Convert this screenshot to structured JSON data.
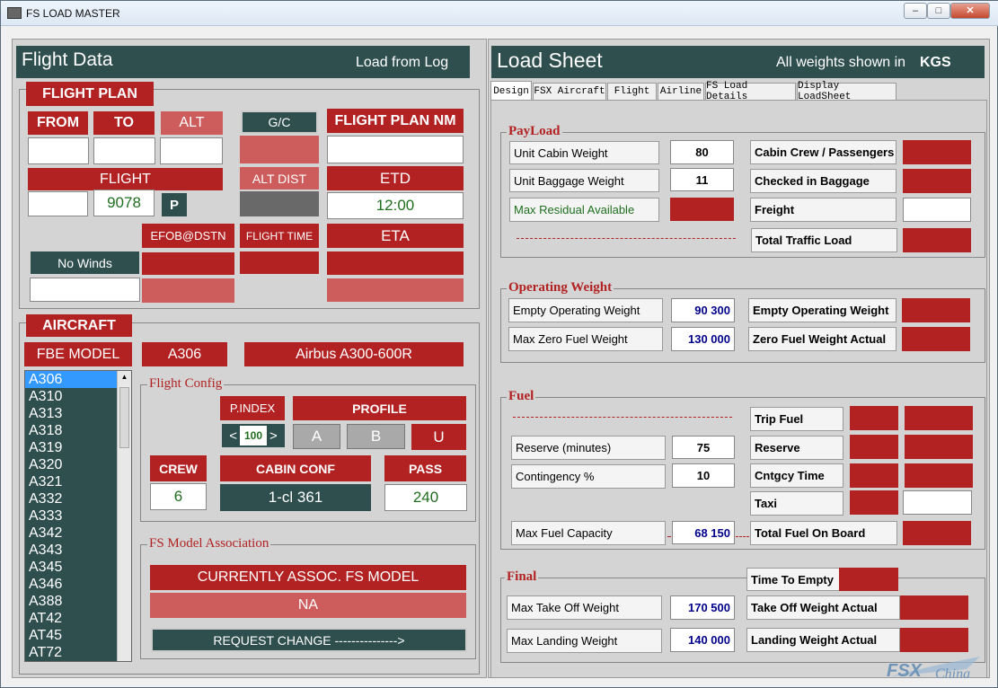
{
  "window": {
    "title": "FS LOAD MASTER"
  },
  "left": {
    "title": "Flight Data",
    "load_log": "Load from Log",
    "flight_plan": {
      "header": "FLIGHT PLAN",
      "from": "FROM",
      "to": "TO",
      "alt": "ALT",
      "gc": "G/C",
      "fp_nm": "FLIGHT PLAN NM",
      "flight": "FLIGHT",
      "flight_no": "9078",
      "p": "P",
      "alt_dist": "ALT DIST",
      "etd": "ETD",
      "etd_value": "12:00",
      "efob": "EFOB@DSTN",
      "flight_time": "FLIGHT TIME",
      "eta": "ETA",
      "no_winds": "No Winds"
    },
    "aircraft": {
      "header": "AIRCRAFT",
      "fbe_model": "FBE MODEL",
      "model": "A306",
      "model_name": "Airbus A300-600R",
      "list": [
        "A306",
        "A310",
        "A313",
        "A318",
        "A319",
        "A320",
        "A321",
        "A332",
        "A333",
        "A342",
        "A343",
        "A345",
        "A346",
        "A388",
        "AT42",
        "AT45",
        "AT72"
      ],
      "flight_config": "Flight Config",
      "pindex": "P.INDEX",
      "pindex_value": "100",
      "profile": "PROFILE",
      "a": "A",
      "b": "B",
      "u": "U",
      "crew": "CREW",
      "crew_value": "6",
      "cabin_conf": "CABIN CONF",
      "cabin_conf_value": "1-cl  361",
      "pass": "PASS",
      "pass_value": "240",
      "fs_assoc": "FS Model Association",
      "curr_assoc": "CURRENTLY ASSOC.  FS MODEL",
      "assoc_value": "NA",
      "request_change": "REQUEST CHANGE --------------->"
    }
  },
  "right": {
    "title": "Load Sheet",
    "weights_note": "All weights shown in",
    "unit": "KGS",
    "tabs": [
      "Design",
      "FSX Aircraft",
      "Flight",
      "Airline",
      "FS Load Details",
      "Display LoadSheet"
    ],
    "payload": {
      "legend": "PayLoad",
      "unit_cabin": "Unit Cabin Weight",
      "unit_cabin_value": "80",
      "unit_bag": "Unit Baggage Weight",
      "unit_bag_value": "11",
      "max_resid": "Max Residual Available",
      "crew_pax": "Cabin Crew / Passengers",
      "checked_bag": "Checked in Baggage",
      "freight": "Freight",
      "total_traffic": "Total Traffic Load"
    },
    "operating": {
      "legend": "Operating Weight",
      "empty_op": "Empty Operating Weight",
      "empty_op_value": "90 300",
      "max_zf": "Max Zero Fuel Weight",
      "max_zf_value": "130 000",
      "empty_op_r": "Empty Operating Weight",
      "zfw_actual": "Zero Fuel Weight Actual"
    },
    "fuel": {
      "legend": "Fuel",
      "trip": "Trip Fuel",
      "reserve_min": "Reserve (minutes)",
      "reserve_min_value": "75",
      "reserve": "Reserve",
      "contingency": "Contingency %",
      "contingency_value": "10",
      "cntgcy_time": "Cntgcy Time",
      "taxi": "Taxi",
      "max_fuel": "Max Fuel Capacity",
      "max_fuel_value": "68 150",
      "total_fob": "Total Fuel On Board"
    },
    "final": {
      "legend": "Final",
      "time_empty": "Time To Empty",
      "mtow": "Max Take Off Weight",
      "mtow_value": "170 500",
      "tow_actual": "Take Off Weight Actual",
      "mlw": "Max Landing Weight",
      "mlw_value": "140 000",
      "lw_actual": "Landing Weight Actual"
    }
  }
}
